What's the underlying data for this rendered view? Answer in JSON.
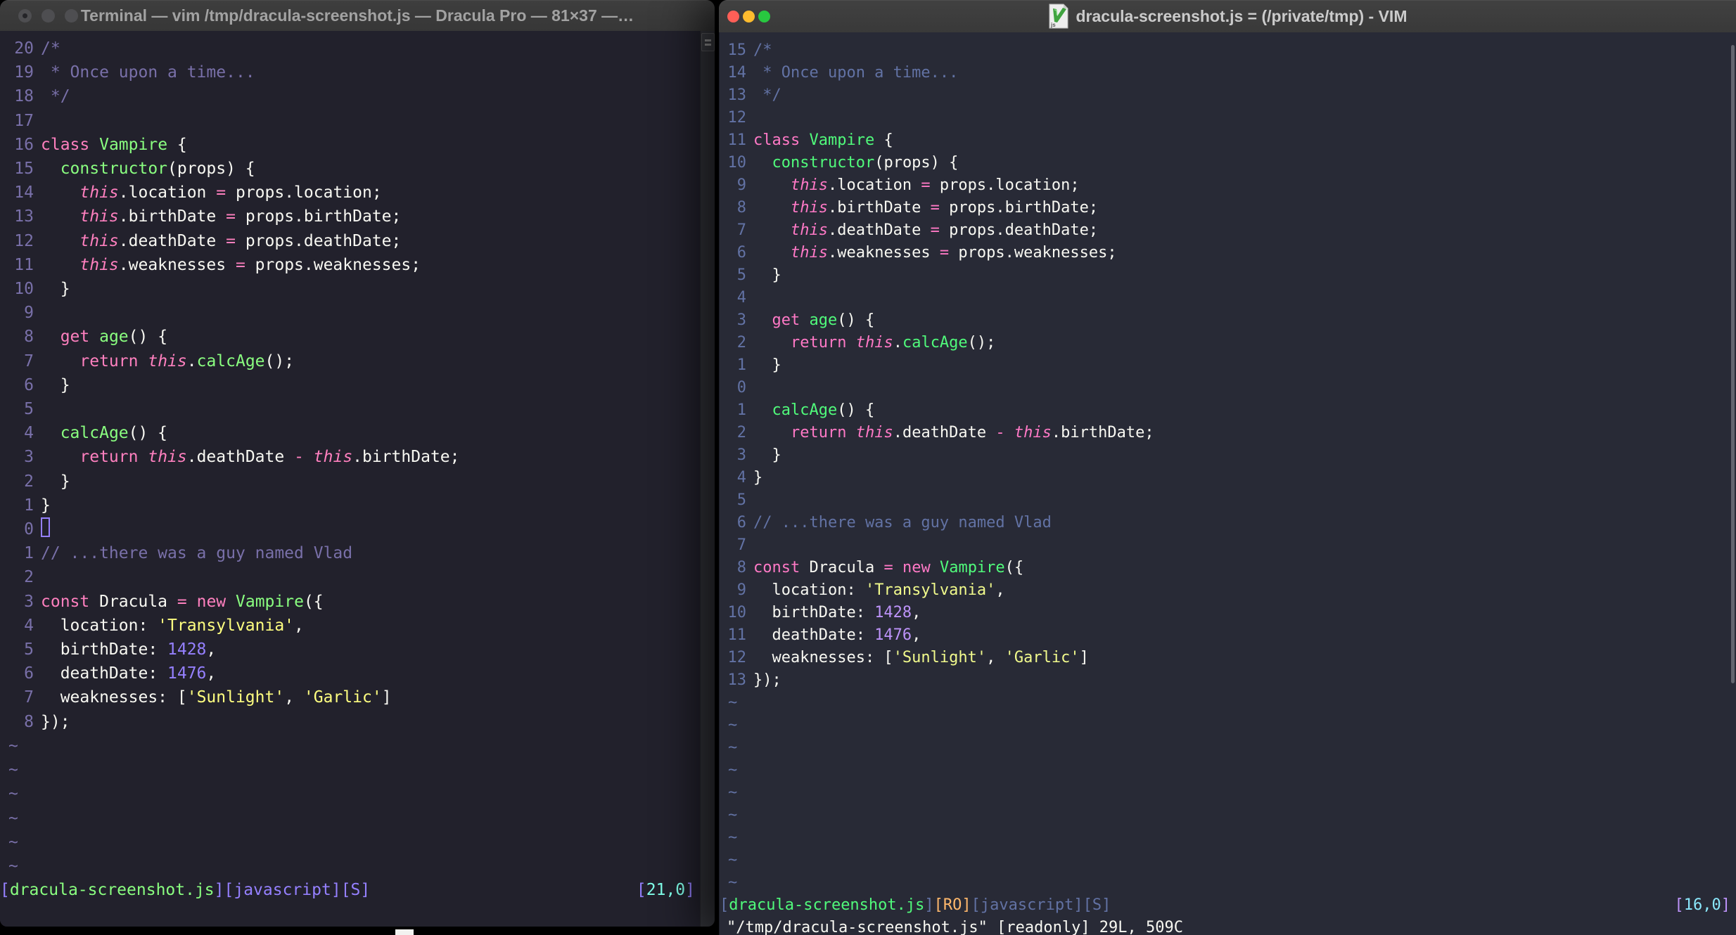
{
  "code_lines": [
    {
      "tokens": [
        [
          "c",
          "/*"
        ]
      ]
    },
    {
      "tokens": [
        [
          "c",
          " * Once upon a time..."
        ]
      ]
    },
    {
      "tokens": [
        [
          "c",
          " */"
        ]
      ]
    },
    {
      "tokens": []
    },
    {
      "tokens": [
        [
          "p",
          "class"
        ],
        [
          "f",
          " "
        ],
        [
          "g",
          "Vampire"
        ],
        [
          "f",
          " {"
        ]
      ]
    },
    {
      "tokens": [
        [
          "f",
          "  "
        ],
        [
          "g",
          "constructor"
        ],
        [
          "f",
          "(props) {"
        ]
      ]
    },
    {
      "tokens": [
        [
          "f",
          "    "
        ],
        [
          "t",
          "this"
        ],
        [
          "f",
          ".location "
        ],
        [
          "p",
          "="
        ],
        [
          "f",
          " props.location;"
        ]
      ]
    },
    {
      "tokens": [
        [
          "f",
          "    "
        ],
        [
          "t",
          "this"
        ],
        [
          "f",
          ".birthDate "
        ],
        [
          "p",
          "="
        ],
        [
          "f",
          " props.birthDate;"
        ]
      ]
    },
    {
      "tokens": [
        [
          "f",
          "    "
        ],
        [
          "t",
          "this"
        ],
        [
          "f",
          ".deathDate "
        ],
        [
          "p",
          "="
        ],
        [
          "f",
          " props.deathDate;"
        ]
      ]
    },
    {
      "tokens": [
        [
          "f",
          "    "
        ],
        [
          "t",
          "this"
        ],
        [
          "f",
          ".weaknesses "
        ],
        [
          "p",
          "="
        ],
        [
          "f",
          " props.weaknesses;"
        ]
      ]
    },
    {
      "tokens": [
        [
          "f",
          "  }"
        ]
      ]
    },
    {
      "tokens": []
    },
    {
      "tokens": [
        [
          "f",
          "  "
        ],
        [
          "p",
          "get"
        ],
        [
          "f",
          " "
        ],
        [
          "g",
          "age"
        ],
        [
          "f",
          "() {"
        ]
      ]
    },
    {
      "tokens": [
        [
          "f",
          "    "
        ],
        [
          "p",
          "return"
        ],
        [
          "f",
          " "
        ],
        [
          "t",
          "this"
        ],
        [
          "f",
          "."
        ],
        [
          "g",
          "calcAge"
        ],
        [
          "f",
          "();"
        ]
      ]
    },
    {
      "tokens": [
        [
          "f",
          "  }"
        ]
      ]
    },
    {
      "tokens": []
    },
    {
      "tokens": [
        [
          "f",
          "  "
        ],
        [
          "g",
          "calcAge"
        ],
        [
          "f",
          "() {"
        ]
      ]
    },
    {
      "tokens": [
        [
          "f",
          "    "
        ],
        [
          "p",
          "return"
        ],
        [
          "f",
          " "
        ],
        [
          "t",
          "this"
        ],
        [
          "f",
          ".deathDate "
        ],
        [
          "p",
          "-"
        ],
        [
          "f",
          " "
        ],
        [
          "t",
          "this"
        ],
        [
          "f",
          ".birthDate;"
        ]
      ]
    },
    {
      "tokens": [
        [
          "f",
          "  }"
        ]
      ]
    },
    {
      "tokens": [
        [
          "f",
          "}"
        ]
      ]
    },
    {
      "tokens": []
    },
    {
      "tokens": [
        [
          "c",
          "// ...there was a guy named Vlad"
        ]
      ]
    },
    {
      "tokens": []
    },
    {
      "tokens": [
        [
          "p",
          "const"
        ],
        [
          "f",
          " Dracula "
        ],
        [
          "p",
          "="
        ],
        [
          "f",
          " "
        ],
        [
          "p",
          "new"
        ],
        [
          "f",
          " "
        ],
        [
          "g",
          "Vampire"
        ],
        [
          "f",
          "({"
        ]
      ]
    },
    {
      "tokens": [
        [
          "f",
          "  location: "
        ],
        [
          "y",
          "'Transylvania'"
        ],
        [
          "f",
          ","
        ]
      ]
    },
    {
      "tokens": [
        [
          "f",
          "  birthDate: "
        ],
        [
          "n",
          "1428"
        ],
        [
          "f",
          ","
        ]
      ]
    },
    {
      "tokens": [
        [
          "f",
          "  deathDate: "
        ],
        [
          "n",
          "1476"
        ],
        [
          "f",
          ","
        ]
      ]
    },
    {
      "tokens": [
        [
          "f",
          "  weaknesses: ["
        ],
        [
          "y",
          "'Sunlight'"
        ],
        [
          "f",
          ", "
        ],
        [
          "y",
          "'Garlic'"
        ],
        [
          "f",
          "]"
        ]
      ]
    },
    {
      "tokens": [
        [
          "f",
          "});"
        ]
      ]
    }
  ],
  "left_window": {
    "title": "Terminal — vim /tmp/dracula-screenshot.js — Dracula Pro — 81×37 —…",
    "traffic_lights": {
      "close": "#4e4e51",
      "minimize": "#4e4e51",
      "zoom": "#4e4e51",
      "close_dot": "#242428"
    },
    "palette": {
      "bg": "#22212c",
      "fg": "#f8f8f2",
      "cm": "#7970a9",
      "pk": "#ff80bf",
      "gr": "#8aff80",
      "yl": "#ffff80",
      "pu": "#9580ff",
      "gut": "#7970a9",
      "cur": "#9580ff",
      "sb": "#9580ff",
      "sf": "#8aff80",
      "sm": "#9580ff",
      "so": "#ffb86c",
      "spos": "#80ffea",
      "sposb": "#9580ff"
    },
    "gutter": [
      "20",
      "19",
      "18",
      "17",
      "16",
      "15",
      "14",
      "13",
      "12",
      "11",
      "10",
      "9",
      "8",
      "7",
      "6",
      "5",
      "4",
      "3",
      "2",
      "1",
      "0",
      "1",
      "2",
      "3",
      "4",
      "5",
      "6",
      "7",
      "8"
    ],
    "cursor_line": 21,
    "cursor_style": "hollow",
    "tilde_rows": 6,
    "tilde_char": "~",
    "statusline": {
      "left": [
        [
          "sb",
          "["
        ],
        [
          "sg",
          "dracula-screenshot.js"
        ],
        [
          "sb",
          "]["
        ],
        [
          "sp",
          "javascript"
        ],
        [
          "sb",
          "]["
        ],
        [
          "sp",
          "S"
        ],
        [
          "sb",
          "]"
        ]
      ],
      "right": [
        [
          "sv",
          "["
        ],
        [
          "sc",
          "21,0"
        ],
        [
          "sv",
          "]"
        ]
      ]
    },
    "cmdline": []
  },
  "right_window": {
    "title": "dracula-screenshot.js = (/private/tmp) - VIM",
    "traffic_lights": {
      "close": "#ff5f57",
      "minimize": "#febc2e",
      "zoom": "#28c840"
    },
    "file_icon": "vim-js-document",
    "palette": {
      "bg": "#282a36",
      "fg": "#f8f8f2",
      "cm": "#6272a4",
      "pk": "#ff79c6",
      "gr": "#50fa7b",
      "yl": "#f1fa8c",
      "pu": "#bd93f9",
      "gut": "#6272a4",
      "cur": "#f8f8f2",
      "sb": "#6272a4",
      "sf": "#50fa7b",
      "sm": "#6272a4",
      "so": "#ffb86c",
      "spos": "#8be9fd",
      "sposb": "#bd93f9"
    },
    "gutter": [
      "15",
      "14",
      "13",
      "12",
      "11",
      "10",
      "9",
      "8",
      "7",
      "6",
      "5",
      "4",
      "3",
      "2",
      "1",
      "0",
      "1",
      "2",
      "3",
      "4",
      "5",
      "6",
      "7",
      "8",
      "9",
      "10",
      "11",
      "12",
      "13"
    ],
    "cursor_line": 16,
    "cursor_style": "none",
    "tilde_rows": 9,
    "tilde_char": "~",
    "statusline": {
      "left": [
        [
          "sb",
          "["
        ],
        [
          "sg",
          "dracula-screenshot.js"
        ],
        [
          "sb",
          "]"
        ],
        [
          "so",
          "[RO]"
        ],
        [
          "sb",
          "["
        ],
        [
          "sp",
          "javascript"
        ],
        [
          "sb",
          "]["
        ],
        [
          "sp",
          "S"
        ],
        [
          "sb",
          "]"
        ]
      ],
      "right": [
        [
          "sv",
          "["
        ],
        [
          "sc",
          "16,0"
        ],
        [
          "sv",
          "]"
        ]
      ]
    },
    "cmdline": [
      [
        "f",
        "\"/tmp/dracula-screenshot.js\" [readonly] 29L, 509C"
      ]
    ]
  }
}
